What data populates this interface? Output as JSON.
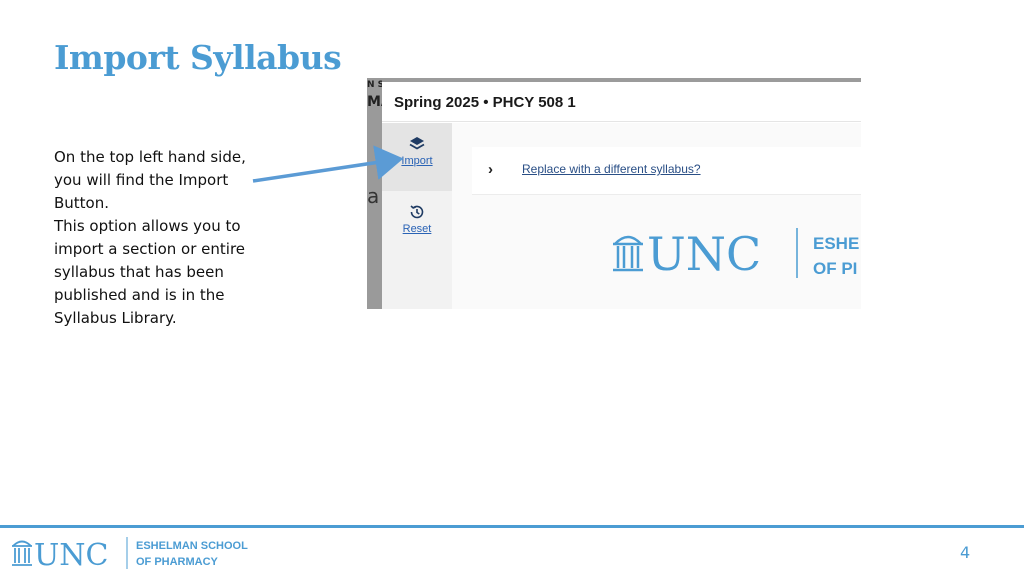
{
  "slide": {
    "title": "Import Syllabus",
    "body_lines": [
      "On the top left hand side,",
      "you will find the Import",
      "Button.",
      "This option allows you to",
      "import a section or entire",
      "syllabus that has been",
      "published and is in the",
      "Syllabus Library."
    ],
    "page_number": "4"
  },
  "screenshot": {
    "left_strip": {
      "line_a": "N SCHOOL",
      "line_b": "MA",
      "line_c": "a"
    },
    "header_title": "Spring 2025 • PHCY 508 1",
    "sidebar": [
      {
        "icon": "layers-icon",
        "label": "Import"
      },
      {
        "icon": "history-icon",
        "label": "Reset"
      }
    ],
    "accordion": {
      "icon": "chevron-right-icon",
      "link": "Replace with a different syllabus?"
    },
    "logo": {
      "wordmark": "UNC",
      "line1": "ESHE",
      "line2": "OF PI"
    }
  },
  "footer": {
    "wordmark": "UNC",
    "school_line1": "ESHELMAN SCHOOL",
    "school_line2": "OF PHARMACY"
  },
  "colors": {
    "brand_blue": "#4b9cd3",
    "link_blue": "#2a63b5",
    "arrow_blue": "#5b9bd5"
  }
}
